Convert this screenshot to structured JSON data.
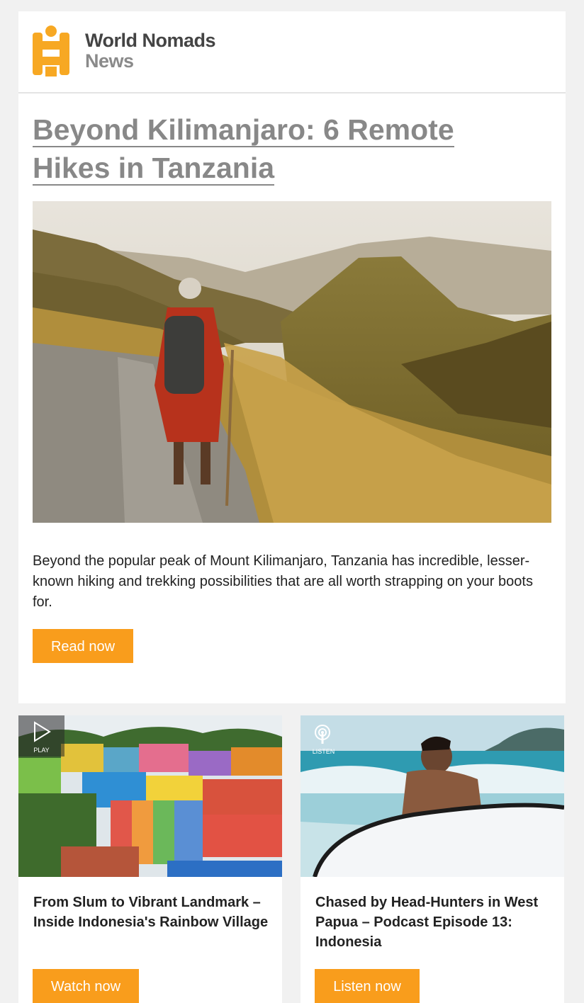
{
  "brand": {
    "name": "World Nomads",
    "sub": "News",
    "accent": "#f99d1c"
  },
  "feature": {
    "title": "Beyond Kilimanjaro: 6 Remote Hikes in Tanzania",
    "image": "hiker-in-red-robe-on-mountain-ridge",
    "description": "Beyond the popular peak of Mount Kilimanjaro, Tanzania has incredible, lesser-known hiking and trekking possibilities that are all worth strapping on your boots for.",
    "cta": "Read now"
  },
  "tiles": [
    {
      "badge_icon": "play-icon",
      "badge_label": "PLAY",
      "image": "colorful-hillside-village",
      "title": "From Slum to Vibrant Landmark – Inside Indonesia's Rainbow Village",
      "cta": "Watch now"
    },
    {
      "badge_icon": "podcast-icon",
      "badge_label": "LISTEN",
      "image": "surfer-holding-board-on-beach",
      "title": "Chased by Head-Hunters in West Papua – Podcast Episode 13: Indonesia",
      "cta": "Listen now"
    }
  ]
}
